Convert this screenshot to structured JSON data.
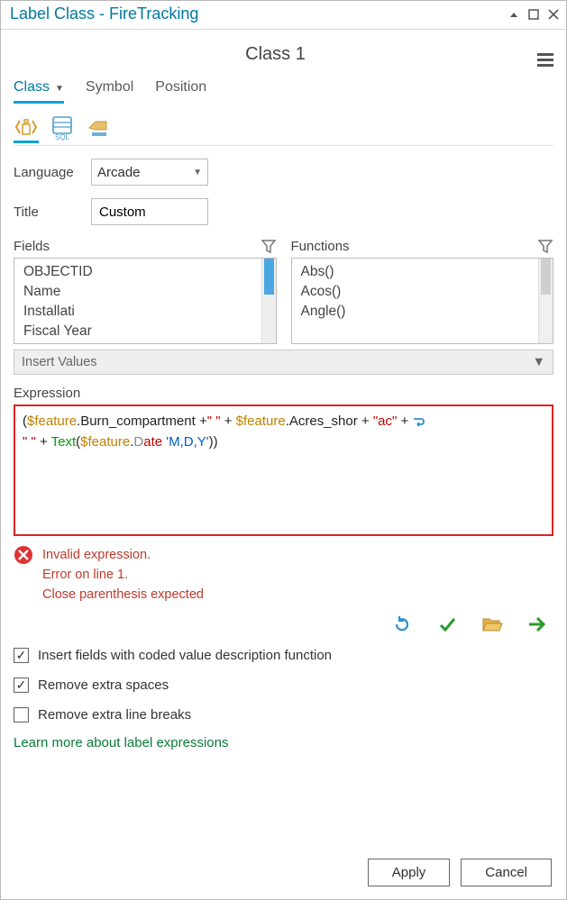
{
  "window": {
    "title": "Label Class - FireTracking"
  },
  "subheader": "Class 1",
  "tabs": {
    "class": "Class",
    "symbol": "Symbol",
    "position": "Position"
  },
  "form": {
    "language_label": "Language",
    "language_value": "Arcade",
    "title_label": "Title",
    "title_value": "Custom"
  },
  "fields": {
    "label": "Fields",
    "items": [
      "OBJECTID",
      "Name",
      "Installati",
      "Fiscal Year"
    ]
  },
  "functions": {
    "label": "Functions",
    "items": [
      "Abs()",
      "Acos()",
      "Angle()"
    ]
  },
  "insert_values": "Insert Values",
  "expression": {
    "label": "Expression",
    "tokens": {
      "p1": "(",
      "v1": "$feature",
      "d1": ".Burn_compartment ",
      "op1": "+",
      "s1": "\" \"",
      "op2": " + ",
      "v2": "$feature",
      "d2": ".Acres_shor ",
      "op3": "+ ",
      "s2": "\"ac\"",
      "op4": " + ",
      "s3": "\" \"",
      "op5": " + ",
      "fn": "Text",
      "p2": "(",
      "v3": "$feature",
      "d3": ".",
      "t_date_a": "D",
      "t_date_b": "ate ",
      "lit": "'M,D,Y'",
      "p3": "))"
    }
  },
  "error": {
    "line1": "Invalid expression.",
    "line2": "Error on line 1.",
    "line3": "Close parenthesis expected"
  },
  "checkboxes": {
    "coded": "Insert fields with coded value description function",
    "spaces": "Remove extra spaces",
    "breaks": "Remove extra line breaks"
  },
  "link": "Learn more about label expressions",
  "buttons": {
    "apply": "Apply",
    "cancel": "Cancel"
  },
  "icons": {
    "sql": "SQL"
  }
}
